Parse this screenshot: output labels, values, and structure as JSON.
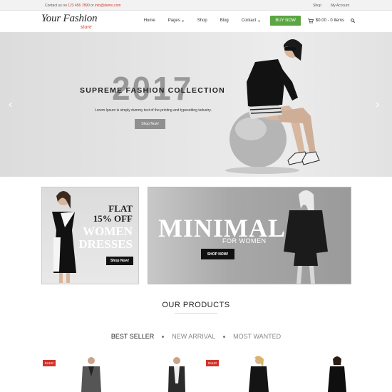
{
  "topbar": {
    "contact_prefix": "Contact us on",
    "phone": "123 456 7890",
    "or": "or",
    "email": "info@demo.com",
    "links": [
      "Shop",
      "My Account"
    ]
  },
  "header": {
    "logo_main": "Your Fashion",
    "logo_sub": "store",
    "nav": [
      {
        "label": "Home",
        "caret": false
      },
      {
        "label": "Pages",
        "caret": true
      },
      {
        "label": "Shop",
        "caret": false
      },
      {
        "label": "Blog",
        "caret": false
      },
      {
        "label": "Contact",
        "caret": true
      }
    ],
    "buy_now": "BUY NOW",
    "cart_text": "$0.00 - 0 Items",
    "icons": {
      "cart": "cart-icon",
      "search": "search-icon",
      "caret": "caret-down-icon"
    }
  },
  "hero": {
    "year": "2017",
    "title": "SUPREME FASHION COLLECTION",
    "description": "Lorem Ipsum is simply dummy text of the printing and typesetting industry.",
    "button": "Shop Now!",
    "arrow_left": "‹",
    "arrow_right": "›"
  },
  "banner_left": {
    "line1": "FLAT",
    "line2": "15% OFF",
    "line3": "WOMEN",
    "line4": "DRESSES",
    "button": "Shop Now!"
  },
  "banner_right": {
    "headline": "MINIMAL",
    "subheadline": "FOR WOMEN",
    "button": "SHOP NOW!"
  },
  "products": {
    "title": "OUR PRODUCTS",
    "tabs": [
      "BEST SELLER",
      "NEW ARRIVAL",
      "MOST WANTED"
    ],
    "active_tab": "BEST SELLER",
    "sale_label": "SALE!"
  },
  "colors": {
    "accent_green": "#5aa642",
    "accent_red": "#d0342c"
  }
}
